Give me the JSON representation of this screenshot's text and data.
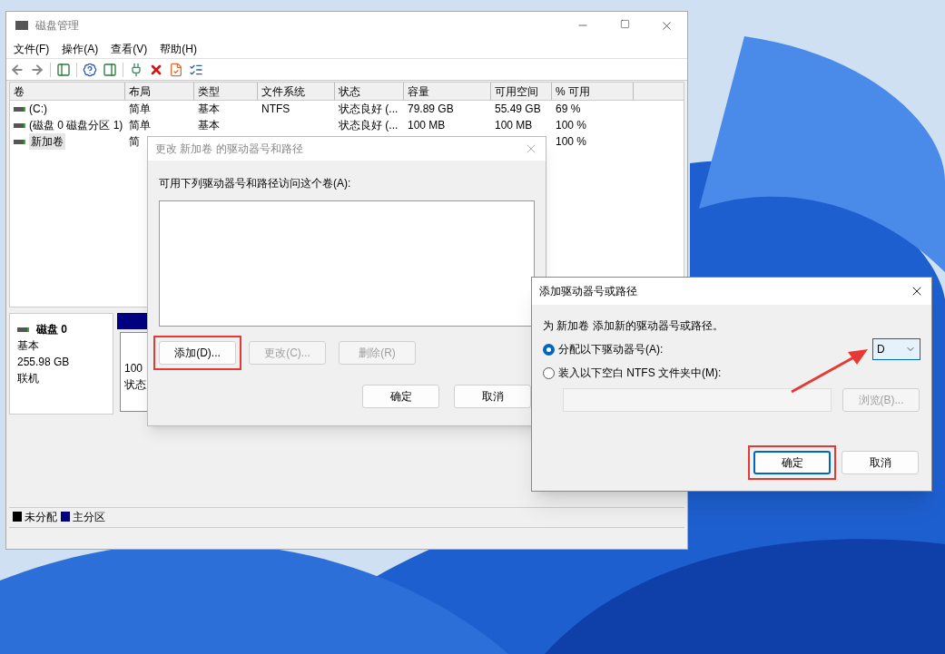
{
  "main_window": {
    "title": "磁盘管理",
    "active": false,
    "menu": [
      "文件(F)",
      "操作(A)",
      "查看(V)",
      "帮助(H)"
    ],
    "columns": [
      "卷",
      "布局",
      "类型",
      "文件系统",
      "状态",
      "容量",
      "可用空间",
      "% 可用"
    ],
    "rows": [
      {
        "selected": false,
        "volume": "(C:)",
        "layout": "简单",
        "type": "基本",
        "fs": "NTFS",
        "status": "状态良好 (...",
        "capacity": "79.89 GB",
        "free": "55.49 GB",
        "pct_free": "69 %"
      },
      {
        "selected": false,
        "volume": "(磁盘 0 磁盘分区 1)",
        "layout": "简单",
        "type": "基本",
        "status": "状态良好 (...",
        "capacity": "100 MB",
        "free": "100 MB",
        "pct_free": "100 %"
      },
      {
        "selected": true,
        "volume": "新加卷",
        "layout": "简",
        "pct_free": "100 %"
      }
    ],
    "disk": {
      "name": "磁盘 0",
      "type": "基本",
      "size": "255.98 GB",
      "status": "联机",
      "partition": [
        "100",
        "状态"
      ]
    },
    "legend": [
      {
        "label": "未分配",
        "color": "#000000"
      },
      {
        "label": "主分区",
        "color": "#000080"
      }
    ]
  },
  "paths_dialog": {
    "title": "更改 新加卷 的驱动器号和路径",
    "active": false,
    "label": "可用下列驱动器号和路径访问这个卷(A):",
    "actions": [
      {
        "label": "添加(D)...",
        "disabled": false,
        "highlighted": true
      },
      {
        "label": "更改(C)...",
        "disabled": true,
        "highlighted": false
      },
      {
        "label": "删除(R)",
        "disabled": true,
        "highlighted": false
      }
    ],
    "ok": "确定",
    "cancel": "取消"
  },
  "add_dialog": {
    "title": "添加驱动器号或路径",
    "active": true,
    "intro": "为 新加卷 添加新的驱动器号或路径。",
    "options": [
      {
        "kind": "letter",
        "label": "分配以下驱动器号(A):",
        "selected": true,
        "value": "D"
      },
      {
        "kind": "folder",
        "label": "装入以下空白 NTFS 文件夹中(M):",
        "selected": false,
        "browse": "浏览(B)..."
      }
    ],
    "folder_disabled": true,
    "ok": {
      "label": "确定",
      "highlighted": true
    },
    "cancel": "取消"
  }
}
